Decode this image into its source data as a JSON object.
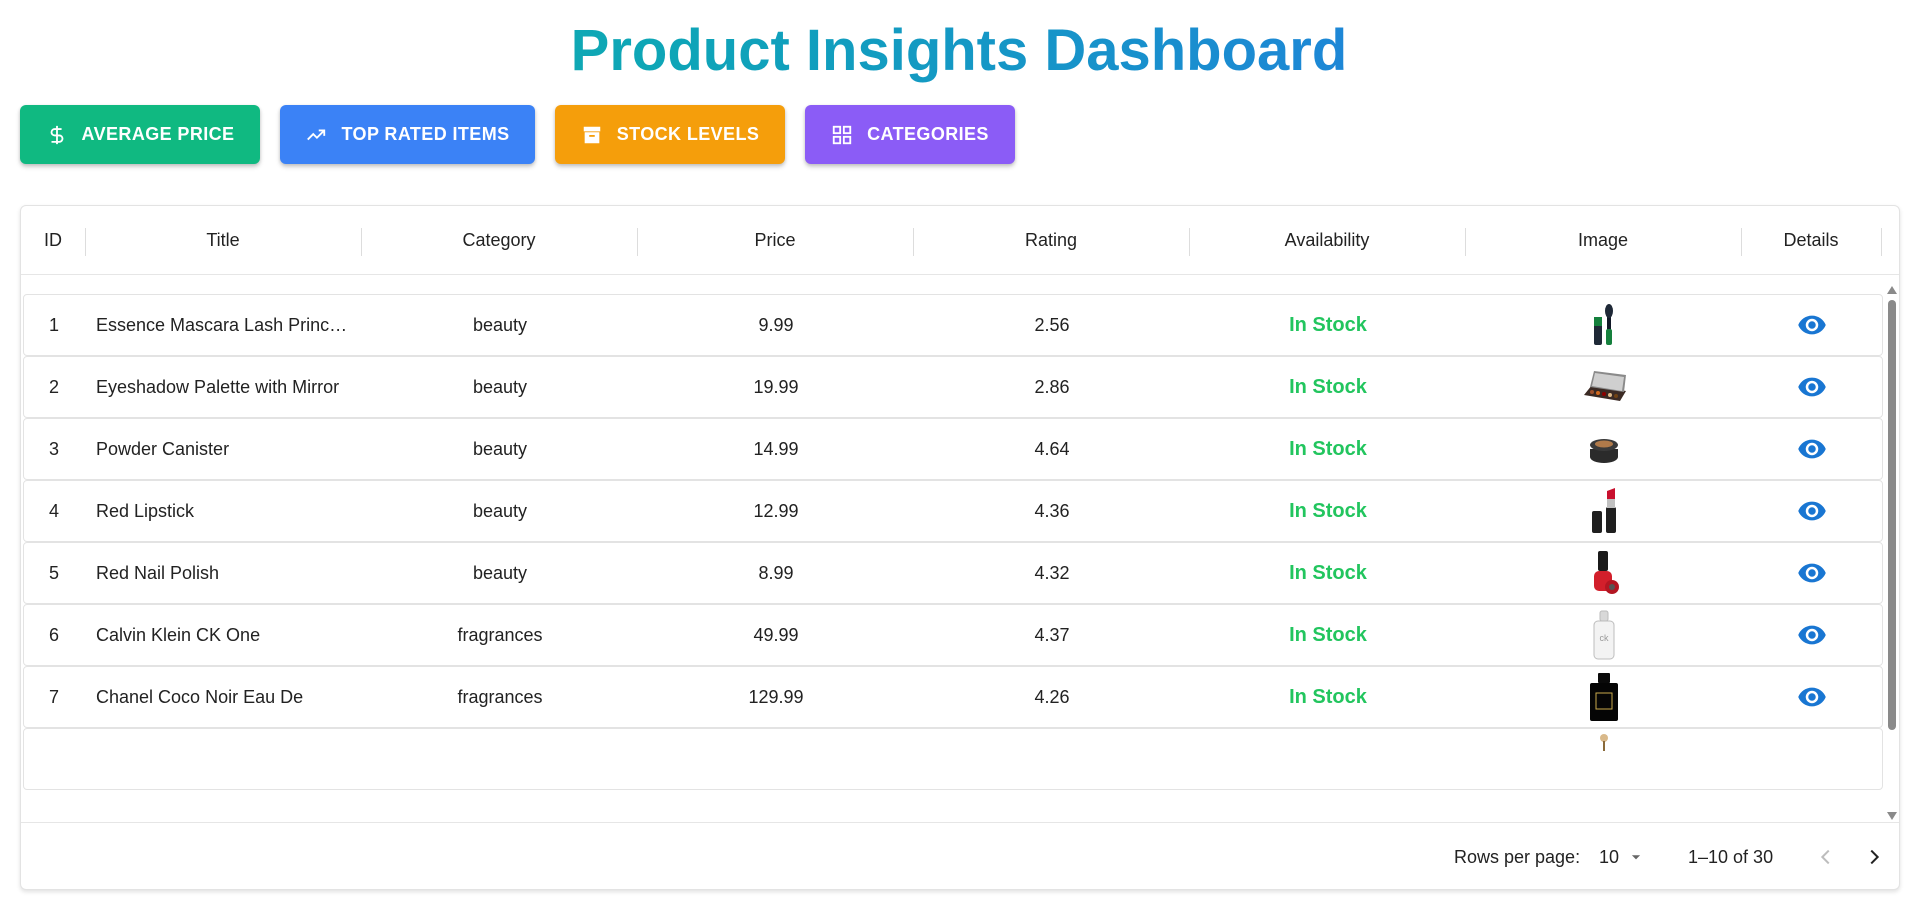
{
  "page": {
    "title": "Product Insights Dashboard"
  },
  "buttons": {
    "avg_price": "AVERAGE PRICE",
    "top_rated": "TOP RATED ITEMS",
    "stock": "STOCK LEVELS",
    "categories": "CATEGORIES"
  },
  "colors": {
    "avg_price": "#10b981",
    "top_rated": "#3b82f6",
    "stock": "#f59e0b",
    "categories": "#8b5cf6",
    "in_stock": "#22c55e",
    "eye": "#1976d2"
  },
  "table": {
    "columns": [
      "ID",
      "Title",
      "Category",
      "Price",
      "Rating",
      "Availability",
      "Image",
      "Details"
    ],
    "rows": [
      {
        "id": "1",
        "title": "Essence Mascara Lash Princ…",
        "category": "beauty",
        "price": "9.99",
        "rating": "2.56",
        "availability": "In Stock",
        "image": "mascara-thumbnail"
      },
      {
        "id": "2",
        "title": "Eyeshadow Palette with Mirror",
        "category": "beauty",
        "price": "19.99",
        "rating": "2.86",
        "availability": "In Stock",
        "image": "eyeshadow-palette-thumbnail"
      },
      {
        "id": "3",
        "title": "Powder Canister",
        "category": "beauty",
        "price": "14.99",
        "rating": "4.64",
        "availability": "In Stock",
        "image": "powder-canister-thumbnail"
      },
      {
        "id": "4",
        "title": "Red Lipstick",
        "category": "beauty",
        "price": "12.99",
        "rating": "4.36",
        "availability": "In Stock",
        "image": "lipstick-thumbnail"
      },
      {
        "id": "5",
        "title": "Red Nail Polish",
        "category": "beauty",
        "price": "8.99",
        "rating": "4.32",
        "availability": "In Stock",
        "image": "nail-polish-thumbnail"
      },
      {
        "id": "6",
        "title": "Calvin Klein CK One",
        "category": "fragrances",
        "price": "49.99",
        "rating": "4.37",
        "availability": "In Stock",
        "image": "ck-one-bottle-thumbnail"
      },
      {
        "id": "7",
        "title": "Chanel Coco Noir Eau De",
        "category": "fragrances",
        "price": "129.99",
        "rating": "4.26",
        "availability": "In Stock",
        "image": "coco-noir-bottle-thumbnail"
      }
    ]
  },
  "pagination": {
    "rows_per_page_label": "Rows per page:",
    "rows_per_page_value": "10",
    "range_label": "1–10 of 30"
  }
}
